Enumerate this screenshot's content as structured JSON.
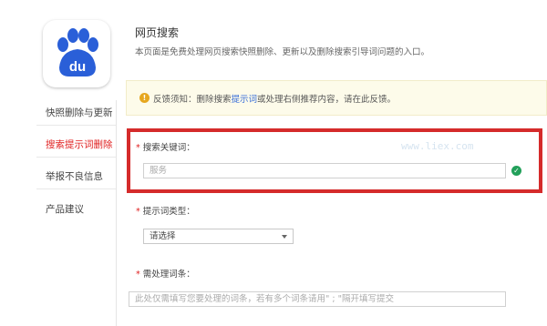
{
  "sidebar": {
    "items": [
      {
        "label": "快照删除与更新",
        "active": false
      },
      {
        "label": "搜索提示词删除",
        "active": true
      },
      {
        "label": "举报不良信息",
        "active": false
      },
      {
        "label": "产品建议",
        "active": false
      }
    ]
  },
  "logo": {
    "text": "du",
    "brand_color": "#2a5fd8"
  },
  "header": {
    "title": "网页搜索",
    "description": "本页面是免费处理网页搜索快照删除、更新以及删除搜索引导词问题的入口。"
  },
  "notice": {
    "icon": "exclamation-icon",
    "prefix": "反馈须知：删除搜索",
    "link": "提示词",
    "suffix": "或处理右侧推荐内容，请在此反馈。"
  },
  "form": {
    "keyword": {
      "label": "搜索关键词：",
      "value": "服务"
    },
    "type": {
      "label": "提示词类型：",
      "selected": "请选择"
    },
    "terms": {
      "label": "需处理词条：",
      "placeholder": "此处仅需填写您要处理的词条，若有多个词条请用\" ; \"隔开填写提交"
    }
  },
  "watermark": "www.liex.com",
  "colors": {
    "accent_red": "#d52b2b",
    "valid_green": "#22a05a",
    "link_blue": "#3a6fd8"
  }
}
